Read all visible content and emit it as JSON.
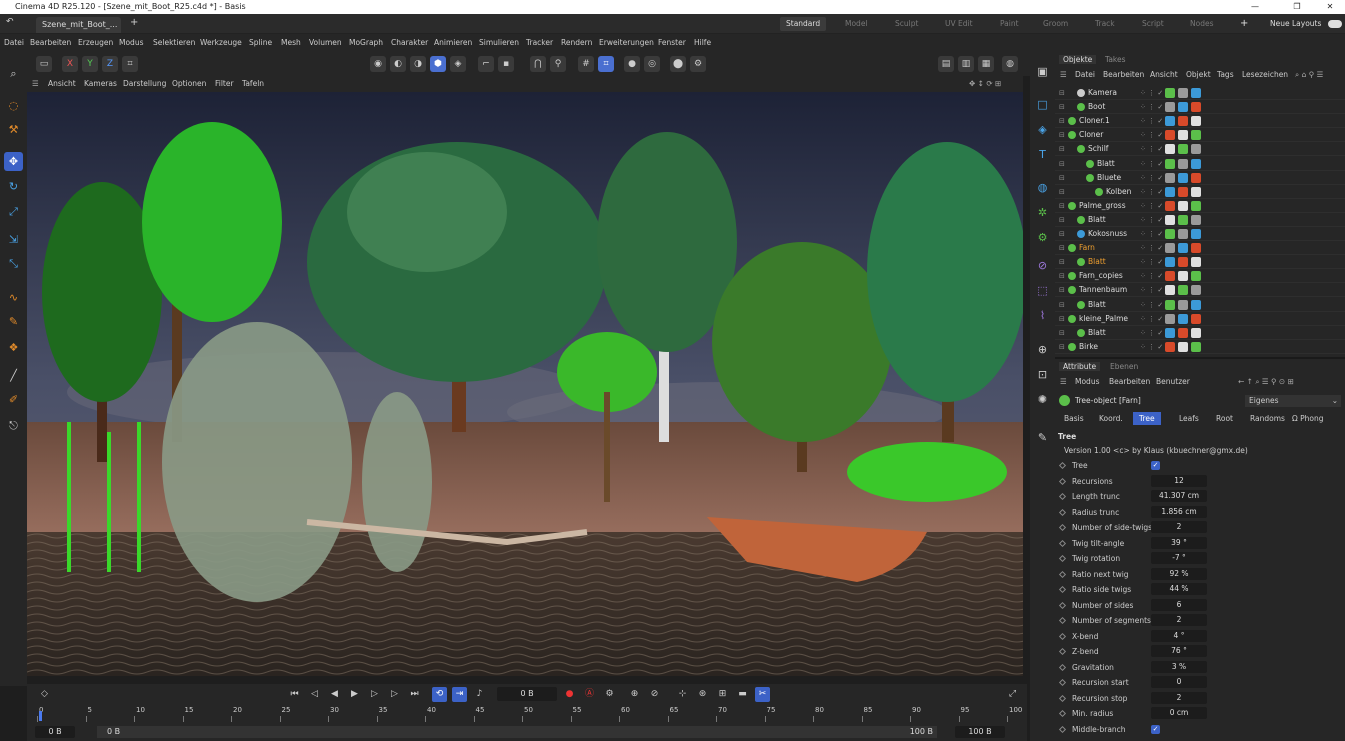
{
  "window": {
    "title": "Cinema 4D R25.120 - [Szene_mit_Boot_R25.c4d *] - Basis"
  },
  "doc_tab": {
    "label": "Szene_mit_Boot_...",
    "close": "×",
    "add": "+"
  },
  "layouts": {
    "items": [
      "Standard",
      "Model",
      "Sculpt",
      "UV Edit",
      "Paint",
      "Groom",
      "Track",
      "Script",
      "Nodes"
    ],
    "active": "Standard",
    "add": "+",
    "new_layouts": "Neue Layouts"
  },
  "menu": [
    "Datei",
    "Bearbeiten",
    "Erzeugen",
    "Modus",
    "Selektieren",
    "Werkzeuge",
    "Spline",
    "Mesh",
    "Volumen",
    "MoGraph",
    "Charakter",
    "Animieren",
    "Simulieren",
    "Tracker",
    "Rendern",
    "Erweiterungen",
    "Fenster",
    "Hilfe"
  ],
  "axes": {
    "x": "X",
    "y": "Y",
    "z": "Z"
  },
  "viewport_menu": [
    "Ansicht",
    "Kameras",
    "Darstellung",
    "Optionen",
    "Filter",
    "Tafeln"
  ],
  "objects_panel": {
    "tabs": [
      "Objekte",
      "Takes"
    ],
    "menu": [
      "Datei",
      "Bearbeiten",
      "Ansicht",
      "Objekt",
      "Tags",
      "Lesezeichen"
    ],
    "rows": [
      {
        "name": "Kamera",
        "indent": 1,
        "highlight": false
      },
      {
        "name": "Boot",
        "indent": 1,
        "highlight": false
      },
      {
        "name": "Cloner.1",
        "indent": 0,
        "highlight": false
      },
      {
        "name": "Cloner",
        "indent": 0,
        "highlight": false
      },
      {
        "name": "Schilf",
        "indent": 1,
        "highlight": false
      },
      {
        "name": "Blatt",
        "indent": 2,
        "highlight": false
      },
      {
        "name": "Bluete",
        "indent": 2,
        "highlight": false
      },
      {
        "name": "Kolben",
        "indent": 3,
        "highlight": false
      },
      {
        "name": "Palme_gross",
        "indent": 0,
        "highlight": false
      },
      {
        "name": "Blatt",
        "indent": 1,
        "highlight": false
      },
      {
        "name": "Kokosnuss",
        "indent": 1,
        "highlight": false
      },
      {
        "name": "Farn",
        "indent": 0,
        "highlight": true
      },
      {
        "name": "Blatt",
        "indent": 1,
        "highlight": true
      },
      {
        "name": "Farn_copies",
        "indent": 0,
        "highlight": false
      },
      {
        "name": "Tannenbaum",
        "indent": 0,
        "highlight": false
      },
      {
        "name": "Blatt",
        "indent": 1,
        "highlight": false
      },
      {
        "name": "kleine_Palme",
        "indent": 0,
        "highlight": false
      },
      {
        "name": "Blatt",
        "indent": 1,
        "highlight": false
      },
      {
        "name": "Birke",
        "indent": 0,
        "highlight": false
      }
    ]
  },
  "attributes_panel": {
    "tabs": [
      "Attribute",
      "Ebenen"
    ],
    "menu": [
      "Modus",
      "Bearbeiten",
      "Benutzer"
    ],
    "object_name": "Tree-object [Farn]",
    "dropdown": "Eigenes",
    "subtabs": [
      "Basis",
      "Koord.",
      "Tree",
      "Leafs",
      "Root",
      "Randoms",
      "Phong"
    ],
    "active_subtab": "Tree",
    "section": "Tree",
    "version": "Version 1.00 <c> by Klaus (kbuechner@gmx.de)",
    "params": [
      {
        "label": "Tree",
        "value": "✓",
        "checkbox": true
      },
      {
        "label": "Recursions",
        "value": "12"
      },
      {
        "label": "Length trunc",
        "value": "41.307 cm"
      },
      {
        "label": "Radius trunc",
        "value": "1.856 cm"
      },
      {
        "label": "Number of side-twigs",
        "value": "2"
      },
      {
        "label": "Twig tilt-angle",
        "value": "39 °"
      },
      {
        "label": "Twig rotation",
        "value": "-7 °"
      },
      {
        "label": "Ratio next twig",
        "value": "92 %"
      },
      {
        "label": "Ratio side twigs",
        "value": "44 %"
      },
      {
        "label": "Number of sides",
        "value": "6"
      },
      {
        "label": "Number of segments",
        "value": "2"
      },
      {
        "label": "X-bend",
        "value": "4 °"
      },
      {
        "label": "Z-bend",
        "value": "76 °"
      },
      {
        "label": "Gravitation",
        "value": "3 %"
      },
      {
        "label": "Recursion start",
        "value": "0"
      },
      {
        "label": "Recursion stop",
        "value": "2"
      },
      {
        "label": "Min. radius",
        "value": "0 cm"
      },
      {
        "label": "Middle-branch",
        "value": "✓",
        "checkbox": true
      }
    ]
  },
  "timeline": {
    "current_frame": "0 B",
    "ticks": [
      "0",
      "5",
      "10",
      "15",
      "20",
      "25",
      "30",
      "35",
      "40",
      "45",
      "50",
      "55",
      "60",
      "65",
      "70",
      "75",
      "80",
      "85",
      "90",
      "95",
      "100"
    ],
    "start_field": "0 B",
    "start_field2": "0 B",
    "end_field": "100 B",
    "end_field2": "100 B"
  }
}
